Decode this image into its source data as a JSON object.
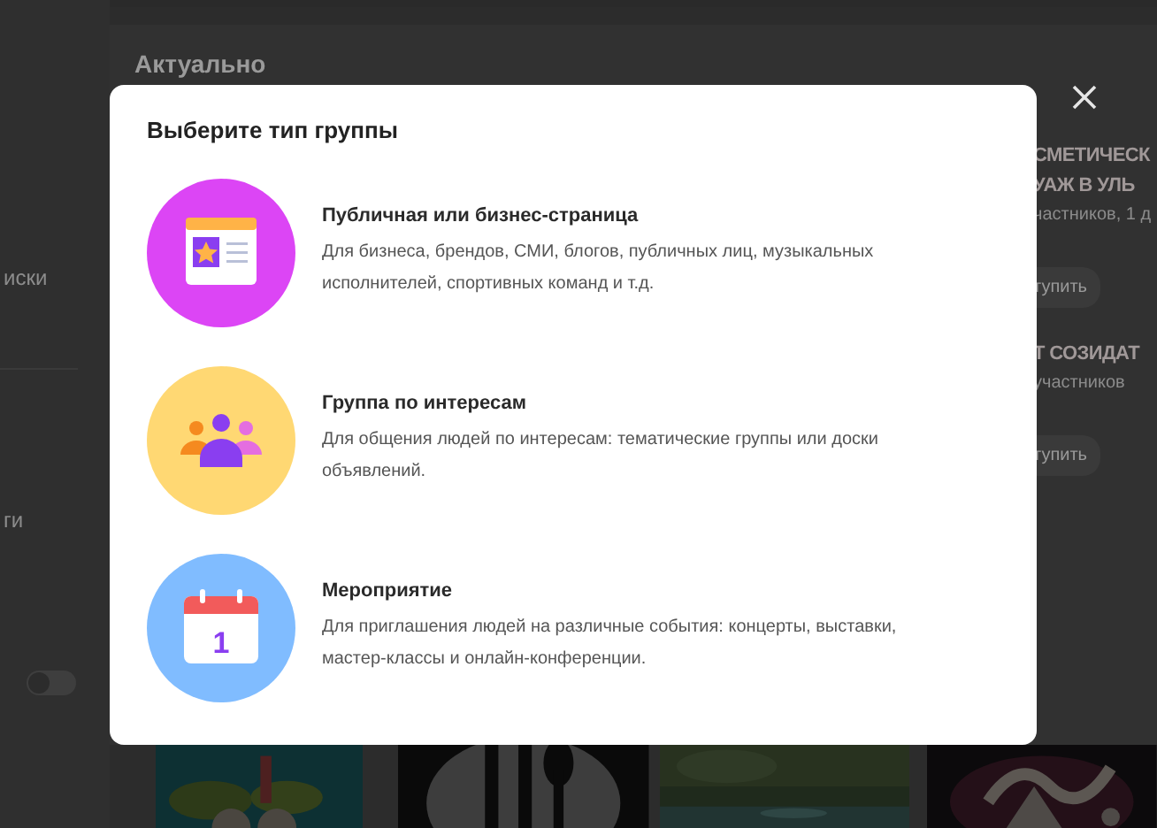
{
  "background": {
    "sidebar": [
      {
        "text": "иски"
      },
      {
        "text": "ги"
      }
    ],
    "sidebar_toggle": {
      "on": false
    },
    "section_title": "Актуально",
    "cards": [
      {
        "title_lines": [
          "СМЕТИЧЕСК",
          "УАЖ В УЛЬ"
        ],
        "meta": "частников, 1 д",
        "button": "тупить"
      },
      {
        "title_lines": [
          "Т СОЗИДАТ"
        ],
        "meta": "участников",
        "button": "тупить"
      }
    ]
  },
  "dialog": {
    "title": "Выберите тип группы",
    "options": [
      {
        "kind": "public",
        "title": "Публичная или бизнес-страница",
        "description": "Для бизнеса, брендов, СМИ, блогов, публичных лиц, музыкальных исполнителей, спортивных команд и т.д."
      },
      {
        "kind": "interests",
        "title": "Группа по интересам",
        "description": "Для общения людей по интересам: тематические группы или доски объявлений."
      },
      {
        "kind": "event",
        "title": "Мероприятие",
        "description": "Для приглашения людей на различные события: концерты, выставки, мастер-классы и онлайн-конференции.",
        "icon_text": "1"
      }
    ]
  }
}
